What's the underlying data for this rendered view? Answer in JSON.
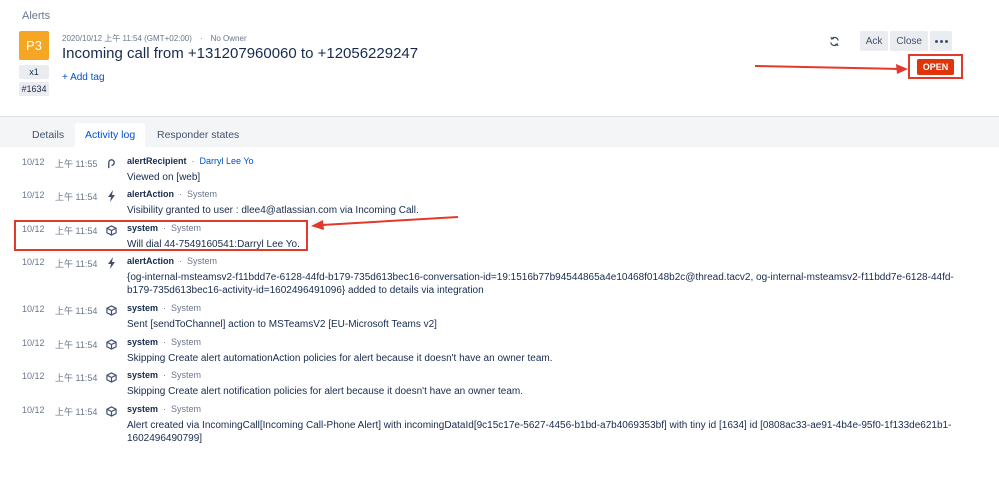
{
  "breadcrumb": "Alerts",
  "alert": {
    "priority": "P3",
    "count": "x1",
    "tiny_id": "#1634",
    "created": "2020/10/12 上午 11:54 (GMT+02:00)",
    "owner": "No Owner",
    "title": "Incoming call from +131207960060 to +12056229247",
    "add_tag": "+ Add tag",
    "status": "OPEN"
  },
  "actions": {
    "ack": "Ack",
    "close": "Close"
  },
  "tabs": [
    {
      "label": "Details",
      "active": false
    },
    {
      "label": "Activity log",
      "active": true
    },
    {
      "label": "Responder states",
      "active": false
    }
  ],
  "log": [
    {
      "date": "10/12",
      "time": "上午 11:55",
      "icon": "recipient-icon",
      "kind": "alertRecipient",
      "who": "Darryl Lee Yo",
      "who_is_link": true,
      "body": "Viewed on [web]"
    },
    {
      "date": "10/12",
      "time": "上午 11:54",
      "icon": "bolt-icon",
      "kind": "alertAction",
      "who": "System",
      "who_is_link": false,
      "body": "Visibility granted to user : dlee4@atlassian.com via Incoming Call."
    },
    {
      "date": "10/12",
      "time": "上午 11:54",
      "icon": "cube-icon",
      "kind": "system",
      "who": "System",
      "who_is_link": false,
      "body": "Will dial 44-7549160541:Darryl Lee Yo."
    },
    {
      "date": "10/12",
      "time": "上午 11:54",
      "icon": "bolt-icon",
      "kind": "alertAction",
      "who": "System",
      "who_is_link": false,
      "body": "{og-internal-msteamsv2-f11bdd7e-6128-44fd-b179-735d613bec16-conversation-id=19:1516b77b94544865a4e10468f0148b2c@thread.tacv2, og-internal-msteamsv2-f11bdd7e-6128-44fd-b179-735d613bec16-activity-id=1602496491096} added to details via integration"
    },
    {
      "date": "10/12",
      "time": "上午 11:54",
      "icon": "cube-icon",
      "kind": "system",
      "who": "System",
      "who_is_link": false,
      "body": "Sent [sendToChannel] action to MSTeamsV2 [EU-Microsoft Teams v2]"
    },
    {
      "date": "10/12",
      "time": "上午 11:54",
      "icon": "cube-icon",
      "kind": "system",
      "who": "System",
      "who_is_link": false,
      "body": "Skipping Create alert automationAction policies for alert because it doesn't have an owner team."
    },
    {
      "date": "10/12",
      "time": "上午 11:54",
      "icon": "cube-icon",
      "kind": "system",
      "who": "System",
      "who_is_link": false,
      "body": "Skipping Create alert notification policies for alert because it doesn't have an owner team."
    },
    {
      "date": "10/12",
      "time": "上午 11:54",
      "icon": "cube-icon",
      "kind": "system",
      "who": "System",
      "who_is_link": false,
      "body": "Alert created via IncomingCall[Incoming Call-Phone Alert] with incomingDataId[9c15c17e-5627-4456-b1bd-a7b4069353bf] with tiny id [1634] id [0808ac33-ae91-4b4e-95f0-1f133de621b1-1602496490799]"
    }
  ],
  "colors": {
    "priority": "#f5a623",
    "status": "#de350b",
    "annotation": "#e2392b",
    "link": "#0052cc"
  }
}
